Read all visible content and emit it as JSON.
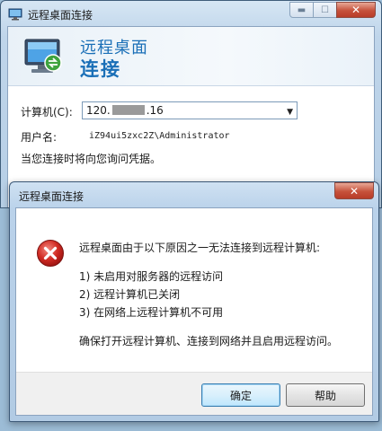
{
  "main_window": {
    "title": "远程桌面连接",
    "banner_line1": "远程桌面",
    "banner_line2": "连接",
    "computer_label": "计算机(C):",
    "computer_value_prefix": "120.",
    "computer_value_suffix": ".16",
    "username_label": "用户名:",
    "username_value": "iZ94ui5zxc2Z\\Administrator",
    "hint": "当您连接时将向您询问凭据。",
    "controls": {
      "minimize": "minimize-icon",
      "maximize": "maximize-icon",
      "close": "close-icon"
    }
  },
  "error_dialog": {
    "title": "远程桌面连接",
    "icon": "error-icon",
    "intro": "远程桌面由于以下原因之一无法连接到远程计算机:",
    "reasons": [
      "1) 未启用对服务器的远程访问",
      "2) 远程计算机已关闭",
      "3) 在网络上远程计算机不可用"
    ],
    "advice": "确保打开远程计算机、连接到网络并且启用远程访问。",
    "ok_label": "确定",
    "help_label": "帮助"
  },
  "colors": {
    "banner_text": "#1a6fb7",
    "close_button": "#c6513b",
    "error_red": "#c8201f"
  }
}
